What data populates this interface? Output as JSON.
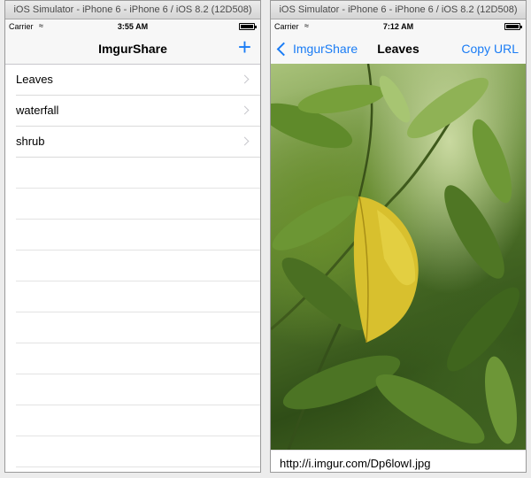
{
  "left": {
    "window_title": "iOS Simulator - iPhone 6 - iPhone 6 / iOS 8.2 (12D508)",
    "status": {
      "carrier": "Carrier",
      "time": "3:55 AM"
    },
    "nav": {
      "title": "ImgurShare",
      "add_label": "+"
    },
    "rows": [
      {
        "label": "Leaves"
      },
      {
        "label": "waterfall"
      },
      {
        "label": "shrub"
      }
    ]
  },
  "right": {
    "window_title": "iOS Simulator - iPhone 6 - iPhone 6 / iOS 8.2 (12D508)",
    "status": {
      "carrier": "Carrier",
      "time": "7:12 AM"
    },
    "nav": {
      "back_label": "ImgurShare",
      "title": "Leaves",
      "copy_label": "Copy URL"
    },
    "url": "http://i.imgur.com/Dp6lowI.jpg"
  },
  "colors": {
    "accent": "#1a7cf5",
    "separator": "#dadada"
  }
}
